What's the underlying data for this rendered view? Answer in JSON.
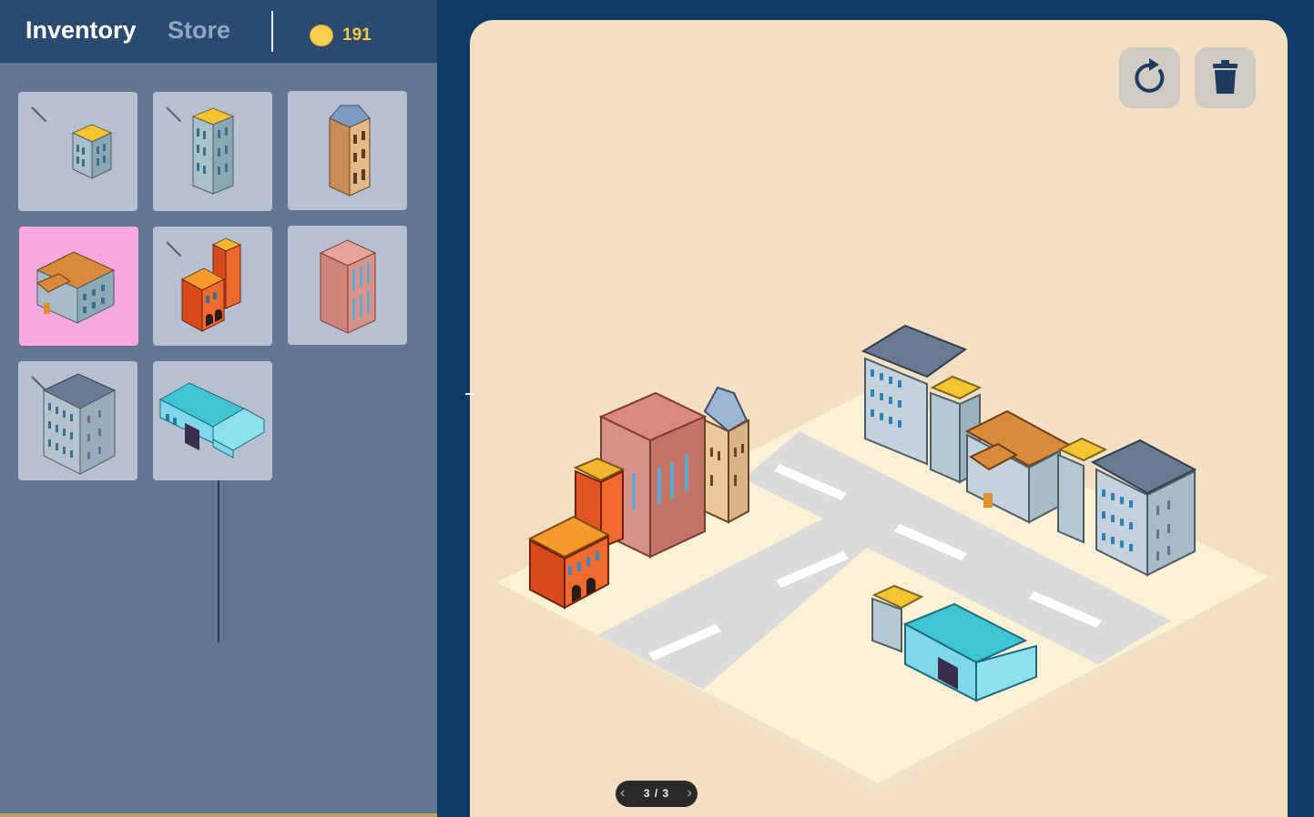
{
  "header": {
    "tabs": [
      {
        "label": "Inventory",
        "active": true
      },
      {
        "label": "Store",
        "active": false
      }
    ],
    "coins": {
      "icon": "coin-icon",
      "count": "191",
      "color": "#f5cf4a"
    }
  },
  "inventory": {
    "items": [
      {
        "name": "small-office-building",
        "linked": true,
        "selected": false
      },
      {
        "name": "tall-office-building",
        "linked": true,
        "selected": false
      },
      {
        "name": "ornate-tower-building",
        "linked": false,
        "selected": false
      },
      {
        "name": "townhall-building",
        "linked": false,
        "selected": true
      },
      {
        "name": "fire-station-building",
        "linked": true,
        "selected": false
      },
      {
        "name": "pink-tower-building",
        "linked": false,
        "selected": false
      },
      {
        "name": "grey-roof-apartment-building",
        "linked": true,
        "selected": false
      },
      {
        "name": "warehouse-building",
        "linked": false,
        "selected": false
      }
    ],
    "selected_color": "#f7a9dd"
  },
  "board": {
    "tools": [
      {
        "name": "refresh-icon"
      },
      {
        "name": "trash-icon"
      }
    ],
    "pager": {
      "text": "3 / 3",
      "prev_icon": "chevron-left-icon",
      "next_icon": "chevron-right-icon"
    }
  }
}
